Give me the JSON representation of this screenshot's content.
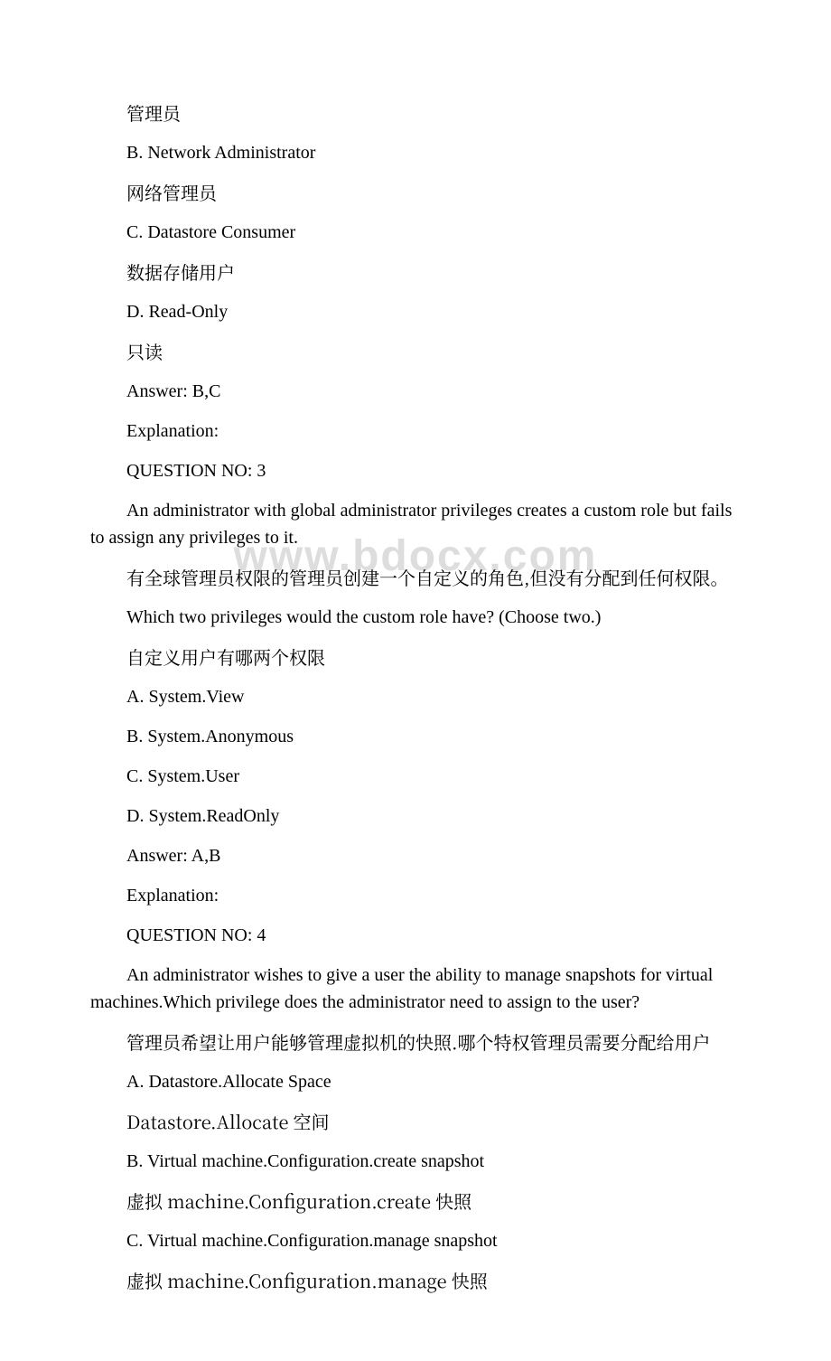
{
  "watermark": "www.bdocx.com",
  "lines": [
    {
      "text": "管理员",
      "cjk": true
    },
    {
      "text": "B. Network Administrator"
    },
    {
      "text": "网络管理员",
      "cjk": true
    },
    {
      "text": "C. Datastore Consumer"
    },
    {
      "text": "数据存储用户",
      "cjk": true
    },
    {
      "text": "D. Read-Only"
    },
    {
      "text": "只读",
      "cjk": true
    },
    {
      "text": "Answer: B,C"
    },
    {
      "text": "Explanation:"
    },
    {
      "text": "QUESTION NO: 3"
    },
    {
      "text": "An administrator with global administrator privileges creates a custom role but fails to assign any privileges to it.",
      "hang": true
    },
    {
      "text": "有全球管理员权限的管理员创建一个自定义的角色,但没有分配到任何权限。",
      "cjk": true
    },
    {
      "text": "Which two privileges would the custom role have? (Choose two.)"
    },
    {
      "text": "自定义用户有哪两个权限",
      "cjk": true
    },
    {
      "text": "A. System.View"
    },
    {
      "text": "B. System.Anonymous"
    },
    {
      "text": "C. System.User"
    },
    {
      "text": "D. System.ReadOnly"
    },
    {
      "text": "Answer: A,B"
    },
    {
      "text": "Explanation:"
    },
    {
      "text": "QUESTION NO: 4"
    },
    {
      "text": "An administrator wishes to give a user the ability to manage snapshots for virtual machines.Which privilege does the administrator need to assign to the user?",
      "hang": true
    },
    {
      "text": "管理员希望让用户能够管理虚拟机的快照.哪个特权管理员需要分配给用户",
      "cjk": true
    },
    {
      "text": "A. Datastore.Allocate Space"
    },
    {
      "text": "Datastore.Allocate 空间",
      "cjk": true
    },
    {
      "text": "B. Virtual machine.Configuration.create snapshot"
    },
    {
      "text": "虚拟 machine.Configuration.create 快照",
      "cjk": true
    },
    {
      "text": "C. Virtual machine.Configuration.manage snapshot"
    },
    {
      "text": "虚拟 machine.Configuration.manage 快照",
      "cjk": true
    }
  ]
}
